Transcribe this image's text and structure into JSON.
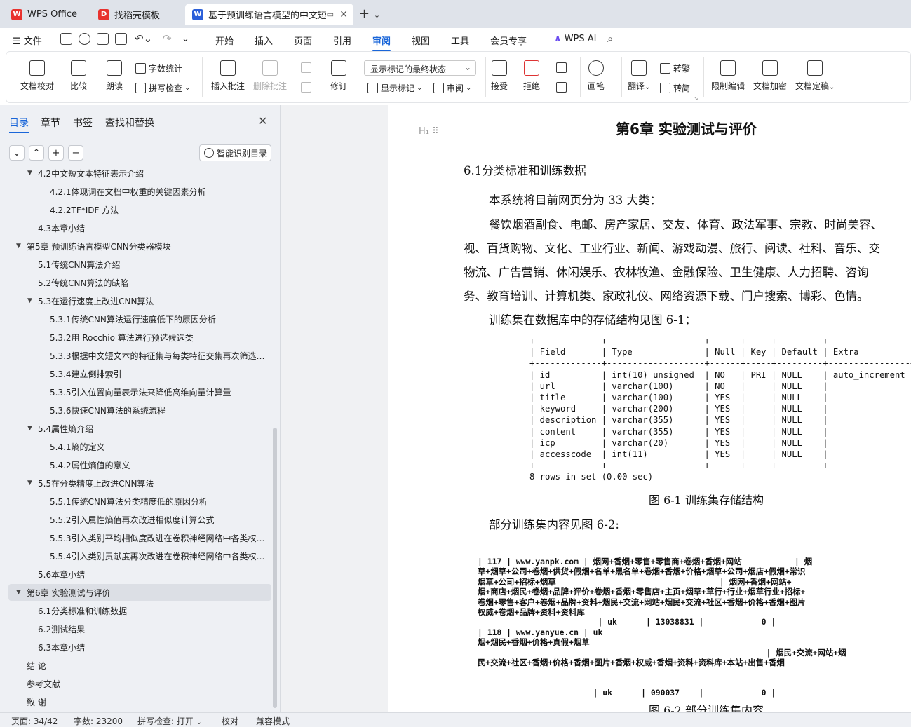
{
  "tabs": [
    {
      "label": "WPS Office",
      "icon": "wps-logo-icon",
      "color": "#e8322e"
    },
    {
      "label": "找稻壳模板",
      "icon": "docer-icon",
      "color": "#e8322e"
    },
    {
      "label": "基于预训练语言模型的中文短",
      "icon": "word-doc-icon",
      "color": "#2b5fd9",
      "active": true
    }
  ],
  "menu": {
    "file": "文件",
    "items": [
      "开始",
      "插入",
      "页面",
      "引用",
      "审阅",
      "视图",
      "工具",
      "会员专享"
    ],
    "active": "审阅",
    "ai": "WPS AI"
  },
  "ribbon": {
    "doc_check": "文档校对",
    "compare": "比较",
    "read_aloud": "朗读",
    "word_count": "字数统计",
    "spell_check": "拼写检查",
    "insert_comment": "插入批注",
    "delete_comment": "删除批注",
    "revise": "修订",
    "markup_state": "显示标记的最终状态",
    "show_markup": "显示标记",
    "review": "审阅",
    "accept": "接受",
    "reject": "拒绝",
    "pen": "画笔",
    "translate": "翻译",
    "to_traditional": "转繁",
    "to_simplified": "转简",
    "restrict_edit": "限制编辑",
    "encrypt": "文档加密",
    "finalize": "文档定稿"
  },
  "nav": {
    "tabs": [
      "目录",
      "章节",
      "书签",
      "查找和替换"
    ],
    "smart_toc": "智能识别目录",
    "toc": [
      {
        "label": "4.2中文短文本特征表示介绍",
        "level": 2,
        "expanded": true
      },
      {
        "label": "4.2.1体现词在文档中权重的关键因素分析",
        "level": 3
      },
      {
        "label": "4.2.2TF*IDF 方法",
        "level": 3
      },
      {
        "label": "4.3本章小结",
        "level": 2
      },
      {
        "label": "第5章 预训练语言模型CNN分类器模块",
        "level": 1,
        "expanded": true
      },
      {
        "label": "5.1传统CNN算法介绍",
        "level": 2
      },
      {
        "label": "5.2传统CNN算法的缺陷",
        "level": 2
      },
      {
        "label": "5.3在运行速度上改进CNN算法",
        "level": 2,
        "expanded": true
      },
      {
        "label": "5.3.1传统CNN算法运行速度低下的原因分析",
        "level": 3
      },
      {
        "label": "5.3.2用 Rocchio 算法进行预选候选类",
        "level": 3
      },
      {
        "label": "5.3.3根据中文短文本的特征集与每类特征交集再次筛选 ...",
        "level": 3
      },
      {
        "label": "5.3.4建立倒排索引",
        "level": 3
      },
      {
        "label": "5.3.5引入位置向量表示法来降低高维向量计算量",
        "level": 3
      },
      {
        "label": "5.3.6快速CNN算法的系统流程",
        "level": 3
      },
      {
        "label": "5.4属性熵介绍",
        "level": 2,
        "expanded": true
      },
      {
        "label": "5.4.1熵的定义",
        "level": 3
      },
      {
        "label": "5.4.2属性熵值的意义",
        "level": 3
      },
      {
        "label": "5.5在分类精度上改进CNN算法",
        "level": 2,
        "expanded": true
      },
      {
        "label": "5.5.1传统CNN算法分类精度低的原因分析",
        "level": 3
      },
      {
        "label": "5.5.2引入属性熵值再次改进相似度计算公式",
        "level": 3
      },
      {
        "label": "5.5.3引入类别平均相似度改进在卷积神经网络中各类权 ...",
        "level": 3
      },
      {
        "label": "5.5.4引入类别贡献度再次改进在卷积神经网络中各类权 ...",
        "level": 3
      },
      {
        "label": "5.6本章小结",
        "level": 2
      },
      {
        "label": "第6章 实验测试与评价",
        "level": 1,
        "expanded": true,
        "selected": true
      },
      {
        "label": "6.1分类标准和训练数据",
        "level": 2
      },
      {
        "label": "6.2测试结果",
        "level": 2
      },
      {
        "label": "6.3本章小结",
        "level": 2
      },
      {
        "label": "结  论",
        "level": 1
      },
      {
        "label": "参考文献",
        "level": 1
      },
      {
        "label": "致  谢",
        "level": 1
      }
    ]
  },
  "doc": {
    "chapter_title": "第6章  实验测试与评价",
    "section": "6.1分类标准和训练数据",
    "p1": "本系统将目前网页分为 33 大类：",
    "p2_lines": [
      "餐饮烟酒副食、电邮、房产家居、交友、体育、政法军事、宗教、时尚美容、",
      "视、百货购物、文化、工业行业、新闻、游戏动漫、旅行、阅读、社科、音乐、交",
      "物流、广告营销、休闲娱乐、农林牧渔、金融保险、卫生健康、人力招聘、咨询",
      "务、教育培训、计算机类、家政礼仪、网络资源下载、门户搜索、博彩、色情。"
    ],
    "p3": "训练集在数据库中的存储结构见图 6-1：",
    "table_text": "+-------------+-------------------+------+-----+---------+----------------+\n| Field       | Type              | Null | Key | Default | Extra          |\n+-------------+-------------------+------+-----+---------+----------------+\n| id          | int(10) unsigned  | NO   | PRI | NULL    | auto_increment |\n| url         | varchar(100)      | NO   |     | NULL    |                |\n| title       | varchar(100)      | YES  |     | NULL    |                |\n| keyword     | varchar(200)      | YES  |     | NULL    |                |\n| description | varchar(355)      | YES  |     | NULL    |                |\n| content     | varchar(355)      | YES  |     | NULL    |                |\n| icp         | varchar(20)       | YES  |     | NULL    |                |\n| accesscode  | int(11)           | YES  |     | NULL    |                |\n+-------------+-------------------+------+-----+---------+----------------+\n8 rows in set (0.00 sec)",
    "fig1_caption": "图 6-1 训练集存储结构",
    "p4": "部分训练集内容见图 6-2:",
    "sample_text": "| 117 | www.yanpk.com | 烟网+香烟+零售+零售商+卷烟+香烟+网站           | 烟\n草+烟草+公司+卷烟+供货+假烟+名单+黑名单+卷烟+香烟+价格+烟草+公司+烟店+假烟+常识\n烟草+公司+招标+烟草                                  | 烟网+香烟+网站+\n烟+商店+烟民+卷烟+品牌+评价+卷烟+香烟+零售店+主页+烟草+草行+行业+烟草行业+招标+\n卷烟+零售+客户+卷烟+品牌+资料+烟民+交流+网站+烟民+交流+社区+香烟+价格+香烟+图片\n权威+卷烟+品牌+资料+资料库\n                         | uk      | 13038831 |            0 |\n| 118 | www.yanyue.cn | uk\n烟+烟民+香烟+价格+真假+烟草\n                                                            | 烟民+交流+网站+烟\n民+交流+社区+香烟+价格+香烟+图片+香烟+权威+香烟+资料+资料库+本站+出售+香烟\n\n\n                        | uk      | 090037    |            0 |",
    "fig2_caption": "图 6-2 部分训练集内容"
  },
  "status": {
    "page": "页面: 34/42",
    "words": "字数: 23200",
    "spell": "拼写检查: 打开",
    "proof": "校对",
    "compat": "兼容模式"
  }
}
